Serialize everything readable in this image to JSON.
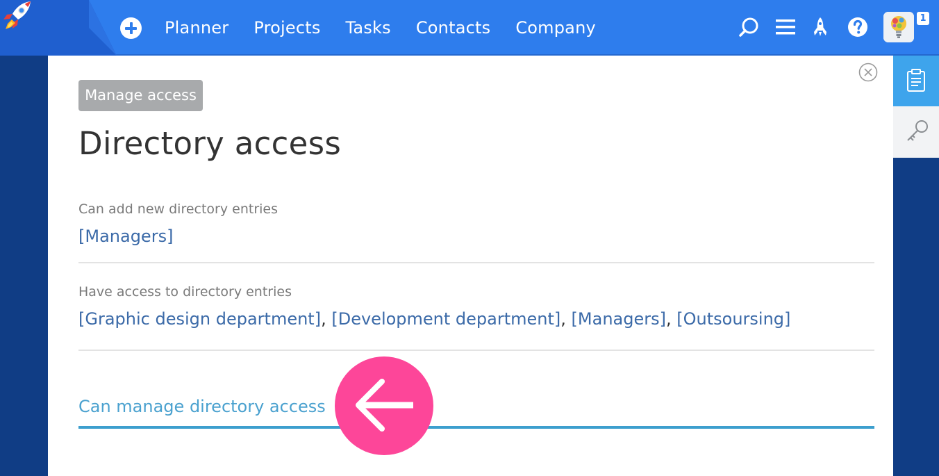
{
  "nav": {
    "items": [
      {
        "id": "planner",
        "label": "Planner"
      },
      {
        "id": "projects",
        "label": "Projects"
      },
      {
        "id": "tasks",
        "label": "Tasks"
      },
      {
        "id": "contacts",
        "label": "Contacts"
      },
      {
        "id": "company",
        "label": "Company"
      }
    ]
  },
  "header": {
    "notification_count": "1",
    "icons": [
      "add-icon",
      "search-icon",
      "menu-icon",
      "rocket-icon",
      "help-icon"
    ]
  },
  "panel": {
    "badge": "Manage access",
    "title": "Directory access",
    "add_entries": {
      "label": "Can add new directory entries",
      "groups": [
        "[Managers]"
      ]
    },
    "access_entries": {
      "label": "Have access to directory entries",
      "groups": [
        "[Graphic design department]",
        "[Development department]",
        "[Managers]",
        "[Outsoursing]"
      ],
      "separator": ","
    },
    "manage_access": {
      "label": "Can manage directory access"
    }
  },
  "colors": {
    "topbar": "#2e7ded",
    "background": "#103d85",
    "link": "#3b6aa8",
    "accent_pink": "#fd4699",
    "active_tab": "#3ea4ec"
  }
}
